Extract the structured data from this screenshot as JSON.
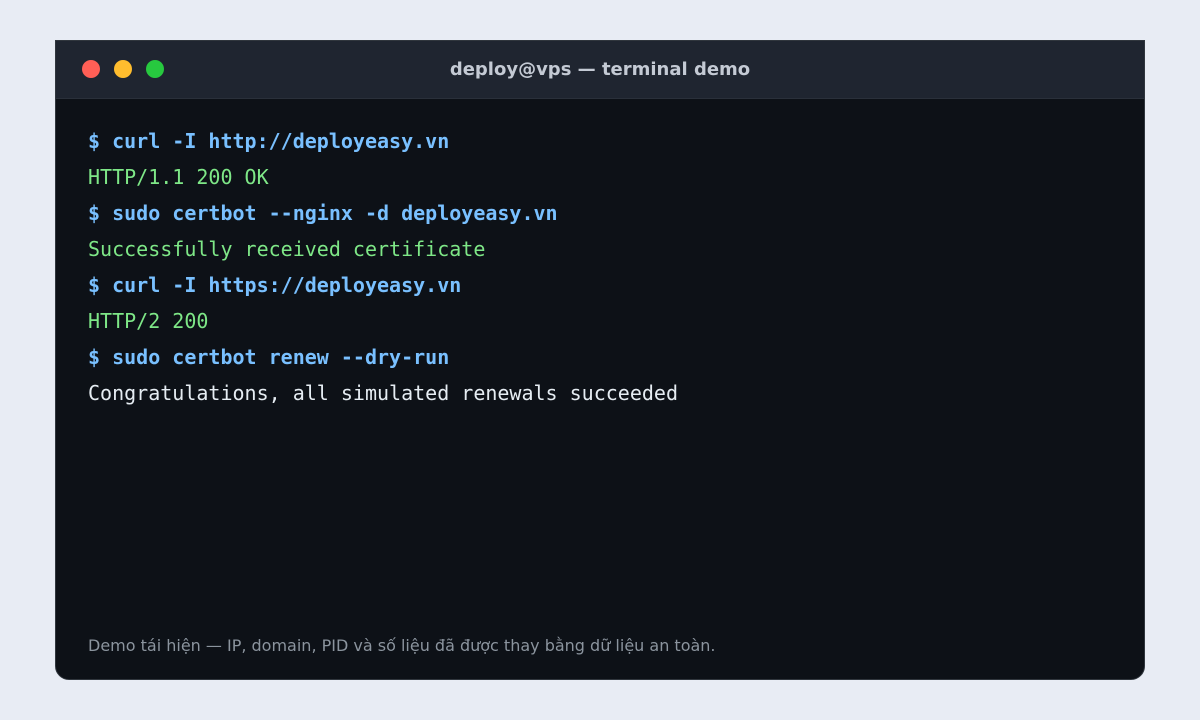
{
  "window": {
    "title": "deploy@vps — terminal demo"
  },
  "terminal": {
    "lines": [
      {
        "text": "$ curl -I http://deployeasy.vn",
        "kind": "cmd"
      },
      {
        "text": "HTTP/1.1 200 OK",
        "kind": "ok"
      },
      {
        "text": "$ sudo certbot --nginx -d deployeasy.vn",
        "kind": "cmd"
      },
      {
        "text": "Successfully received certificate",
        "kind": "ok"
      },
      {
        "text": "$ curl -I https://deployeasy.vn",
        "kind": "cmd"
      },
      {
        "text": "HTTP/2 200",
        "kind": "ok"
      },
      {
        "text": "$ sudo certbot renew --dry-run",
        "kind": "cmd"
      },
      {
        "text": "Congratulations, all simulated renewals succeeded",
        "kind": "plain"
      }
    ]
  },
  "footnote": "Demo tái hiện — IP, domain, PID và số liệu đã được thay bằng dữ liệu an toàn.",
  "colors": {
    "command": "#79c0ff",
    "success": "#7ee787",
    "output": "#e6edf3",
    "terminal_bg": "#0d1117",
    "titlebar_bg": "#1f2530"
  }
}
